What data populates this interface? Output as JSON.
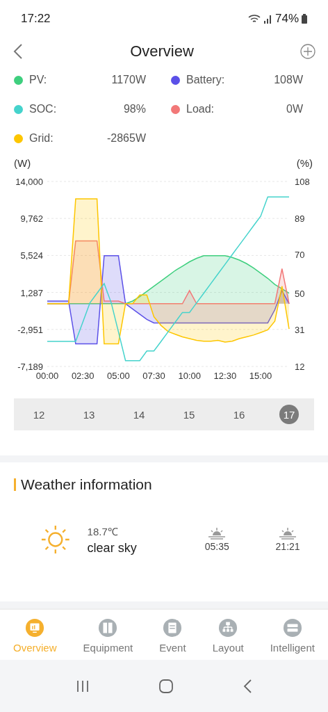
{
  "status_bar": {
    "time": "17:22",
    "battery": "74%"
  },
  "header": {
    "title": "Overview"
  },
  "legend": [
    {
      "label": "PV:",
      "value": "1170W",
      "color": "#3ecf7e"
    },
    {
      "label": "Battery:",
      "value": "108W",
      "color": "#5b50e8"
    },
    {
      "label": "SOC:",
      "value": "98%",
      "color": "#45d3cc"
    },
    {
      "label": "Load:",
      "value": "0W",
      "color": "#f27878"
    },
    {
      "label": "Grid:",
      "value": "-2865W",
      "color": "#fdc600"
    }
  ],
  "chart": {
    "left_unit": "(W)",
    "right_unit": "(%)",
    "chart_data": {
      "type": "area",
      "x": [
        0,
        0.5,
        1,
        1.5,
        2,
        2.5,
        3,
        3.5,
        4,
        4.5,
        5,
        5.5,
        6,
        6.5,
        7,
        7.5,
        8,
        8.5,
        9,
        9.5,
        10,
        10.5,
        11,
        11.5,
        12,
        12.5,
        13,
        13.5,
        14,
        14.5,
        15,
        15.5,
        16,
        16.5,
        17
      ],
      "grid": true,
      "xlim": [
        0,
        17
      ],
      "xticks": [
        {
          "value": 0,
          "label": "00:00"
        },
        {
          "value": 2.5,
          "label": "02:30"
        },
        {
          "value": 5,
          "label": "05:00"
        },
        {
          "value": 7.5,
          "label": "07:30"
        },
        {
          "value": 10,
          "label": "10:00"
        },
        {
          "value": 12.5,
          "label": "12:30"
        },
        {
          "value": 15,
          "label": "15:00"
        }
      ],
      "ylim": [
        -7189,
        14000
      ],
      "yticks": [
        {
          "value": 14000,
          "label": "14,000"
        },
        {
          "value": 9762,
          "label": "9,762"
        },
        {
          "value": 5524,
          "label": "5,524"
        },
        {
          "value": 1287,
          "label": "1,287"
        },
        {
          "value": -2951,
          "label": "-2,951"
        },
        {
          "value": -7189,
          "label": "-7,189"
        }
      ],
      "y2lim": [
        12,
        108
      ],
      "y2ticks": [
        108,
        89,
        70,
        50,
        31,
        12
      ],
      "series": [
        {
          "color": "#3ecf7e",
          "values": [
            0,
            0,
            0,
            0,
            0,
            0,
            0,
            0,
            0,
            0,
            0,
            0,
            300,
            800,
            1400,
            2000,
            2600,
            3200,
            3800,
            4300,
            4800,
            5200,
            5500,
            5500,
            5500,
            5500,
            5300,
            5000,
            4600,
            4100,
            3500,
            2900,
            2200,
            1700,
            1200
          ]
        },
        {
          "color": "#5b50e8",
          "values": [
            300,
            300,
            300,
            300,
            -4600,
            -4600,
            -4600,
            -4600,
            5500,
            5500,
            5500,
            0,
            -600,
            -1200,
            -1800,
            -2200,
            -2200,
            -2200,
            -2200,
            -2200,
            -2200,
            -2200,
            -2200,
            -2200,
            -2200,
            -2200,
            -2200,
            -2200,
            -2200,
            -2200,
            -2200,
            -2200,
            -700,
            1500,
            0
          ]
        },
        {
          "color": "#f27878",
          "values": [
            0,
            0,
            0,
            0,
            7200,
            7200,
            7200,
            7200,
            300,
            300,
            300,
            0,
            0,
            0,
            0,
            0,
            0,
            0,
            0,
            0,
            1500,
            0,
            0,
            0,
            0,
            0,
            0,
            0,
            0,
            0,
            0,
            0,
            0,
            4000,
            0
          ]
        },
        {
          "color": "#fdc600",
          "values": [
            0,
            0,
            0,
            0,
            12000,
            12000,
            12000,
            12000,
            -4600,
            -4600,
            -4600,
            0,
            0,
            1000,
            1000,
            -1500,
            -2500,
            -3200,
            -3500,
            -3800,
            -4000,
            -4200,
            -4300,
            -4300,
            -4200,
            -4400,
            -4300,
            -4000,
            -3800,
            -3600,
            -3300,
            -3000,
            -2000,
            2000,
            -2900
          ]
        },
        {
          "color": "#45d3cc",
          "axis": "y2",
          "type": "line",
          "values": [
            25,
            25,
            25,
            25,
            25,
            35,
            45,
            50,
            55,
            45,
            30,
            15,
            15,
            15,
            20,
            20,
            25,
            30,
            35,
            40,
            40,
            45,
            50,
            55,
            60,
            65,
            70,
            75,
            80,
            85,
            90,
            100,
            100,
            100,
            100
          ]
        }
      ]
    }
  },
  "dates": [
    {
      "label": "12",
      "selected": false
    },
    {
      "label": "13",
      "selected": false
    },
    {
      "label": "14",
      "selected": false
    },
    {
      "label": "15",
      "selected": false
    },
    {
      "label": "16",
      "selected": false
    },
    {
      "label": "17",
      "selected": true
    }
  ],
  "weather": {
    "title": "Weather information",
    "temperature": "18.7℃",
    "condition": "clear sky",
    "sunrise": "05:35",
    "sunset": "21:21"
  },
  "tabs": [
    {
      "label": "Overview",
      "selected": true,
      "kind": "monitor"
    },
    {
      "label": "Equipment",
      "selected": false,
      "kind": "cabinet"
    },
    {
      "label": "Event",
      "selected": false,
      "kind": "clipboard"
    },
    {
      "label": "Layout",
      "selected": false,
      "kind": "tree"
    },
    {
      "label": "Intelligent",
      "selected": false,
      "kind": "server"
    }
  ]
}
